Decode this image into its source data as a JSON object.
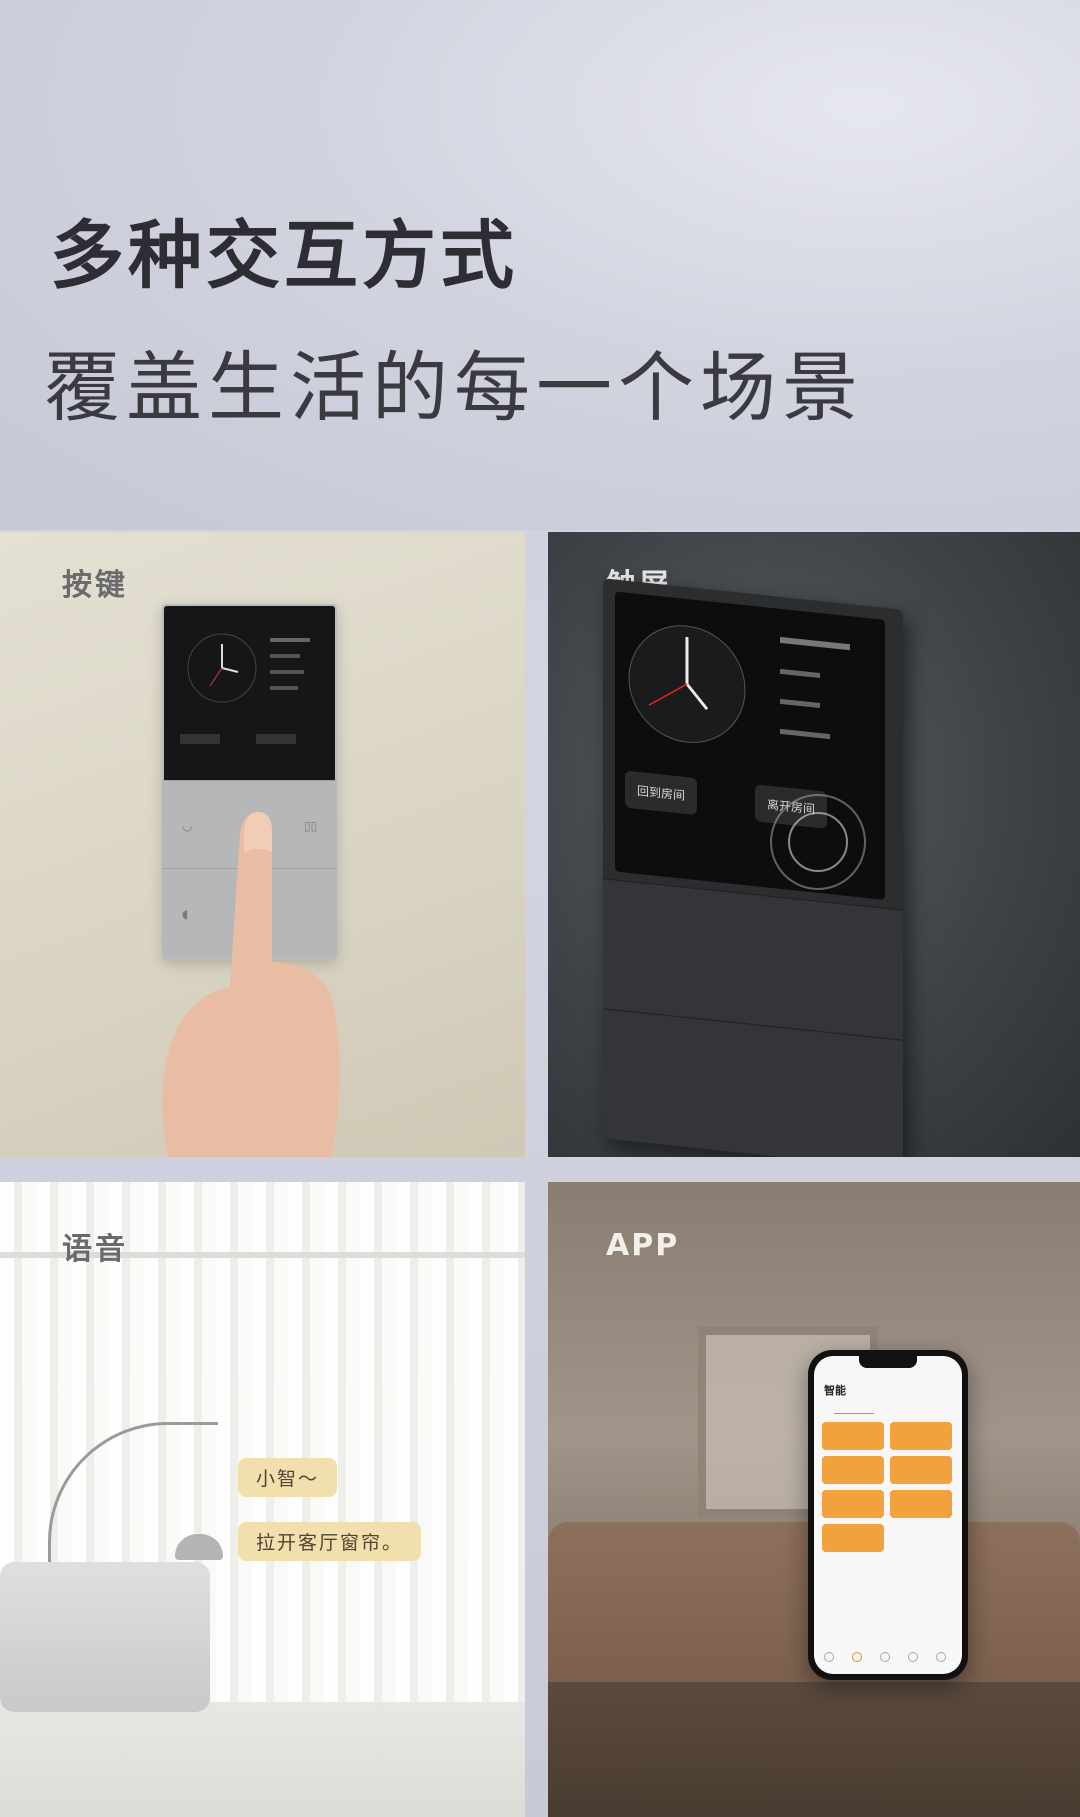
{
  "header": {
    "title": "多种交互方式",
    "subtitle": "覆盖生活的每一个场景"
  },
  "panels": [
    {
      "label": "按键"
    },
    {
      "label": "触屏",
      "buttons": [
        "回到房间",
        "离开房间"
      ]
    },
    {
      "label": "语音",
      "bubbles": [
        "小智～",
        "拉开客厅窗帘。"
      ]
    },
    {
      "label": "APP",
      "app_title": "智能"
    }
  ],
  "colors": {
    "accent_orange": "#f2a23c",
    "bubble_bg": "#f2dfae"
  }
}
